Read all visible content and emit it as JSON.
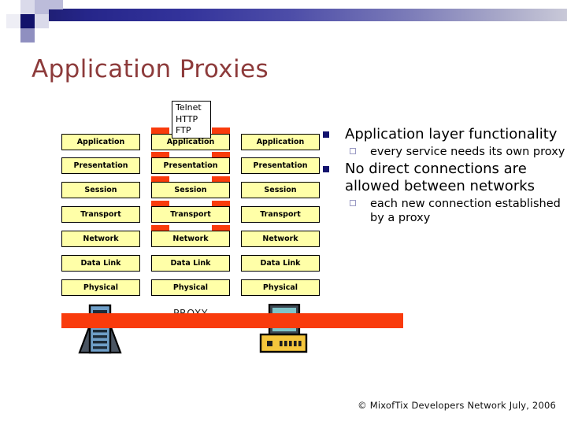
{
  "header": {
    "decoration": "gradient-bar",
    "accent_navy": "#12126b",
    "accent_gradient_start": "#1d1d6e",
    "accent_gradient_end": "#c9c9d8"
  },
  "title": "Application Proxies",
  "title_color": "#8d3b3b",
  "diagram": {
    "callout": {
      "lines": [
        "Telnet",
        "HTTP",
        "FTP"
      ],
      "text": "Telnet\nHTTP\nFTP"
    },
    "layers": [
      "Application",
      "Presentation",
      "Session",
      "Transport",
      "Network",
      "Data Link",
      "Physical"
    ],
    "columns": [
      {
        "id": "left-host",
        "role": "client-host",
        "layers": [
          "Application",
          "Presentation",
          "Session",
          "Transport",
          "Network",
          "Data Link",
          "Physical"
        ],
        "device_icon": "server-icon"
      },
      {
        "id": "middle-proxy",
        "role": "proxy",
        "label": "PROXY",
        "layers": [
          "Application",
          "Presentation",
          "Session",
          "Transport",
          "Network",
          "Data Link",
          "Physical"
        ],
        "device_icon": "none"
      },
      {
        "id": "right-host",
        "role": "destination-host",
        "layers": [
          "Application",
          "Presentation",
          "Session",
          "Transport",
          "Network",
          "Data Link",
          "Physical"
        ],
        "device_icon": "computer-icon"
      }
    ],
    "proxy_label": "PROXY",
    "colors": {
      "layer_fill": "#ffffa8",
      "layer_border": "#000000",
      "connector_red": "#f93b0c",
      "server_body": "#6f9fc8",
      "server_dark": "#2b3a48",
      "monitor_screen": "#7fc4c9",
      "monitor_base": "#f5c63c"
    }
  },
  "bullets": [
    {
      "level": 1,
      "marker": "filled-square",
      "text": "Application layer functionality"
    },
    {
      "level": 2,
      "marker": "hollow-square",
      "text": "every service needs its own proxy"
    },
    {
      "level": 1,
      "marker": "filled-square",
      "text": "No direct connections are allowed between networks"
    },
    {
      "level": 2,
      "marker": "hollow-square",
      "text": "each new connection established by a proxy"
    }
  ],
  "footer": "© MixofTix Developers Network July, 2006"
}
